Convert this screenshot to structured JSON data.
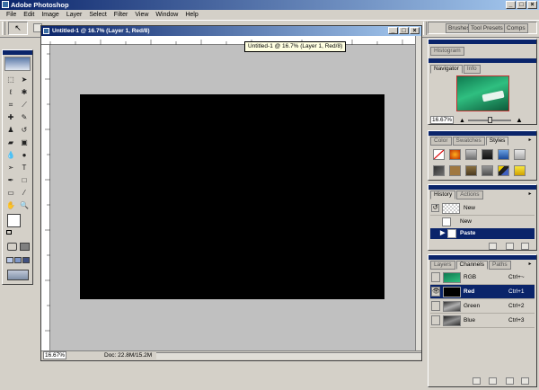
{
  "window": {
    "title": "Adobe Photoshop"
  },
  "menu": [
    "File",
    "Edit",
    "Image",
    "Layer",
    "Select",
    "Filter",
    "View",
    "Window",
    "Help"
  ],
  "palette_well": {
    "tabs": [
      "Brushes",
      "Tool Presets",
      "Comps"
    ]
  },
  "document": {
    "title": "Untitled-1 @ 16.7% (Layer 1, Red/8)",
    "tooltip": "Untitled-1 @ 16.7% (Layer 1, Red/8)",
    "zoom": "16.67%",
    "doc_size": "Doc: 22.8M/15.2M",
    "canvas_color": "#000000"
  },
  "navigator": {
    "tabs": [
      "Histogram",
      "Navigator",
      "Info"
    ],
    "zoom": "16.67%"
  },
  "color_panel": {
    "tabs": [
      "Color",
      "Swatches",
      "Styles"
    ]
  },
  "history": {
    "tabs": [
      "History",
      "Actions"
    ],
    "snapshot_label": "New",
    "items": [
      "New",
      "Paste"
    ]
  },
  "channels": {
    "tabs": [
      "Layers",
      "Channels",
      "Paths"
    ],
    "rows": [
      {
        "name": "RGB",
        "shortcut": "Ctrl+~"
      },
      {
        "name": "Red",
        "shortcut": "Ctrl+1"
      },
      {
        "name": "Green",
        "shortcut": "Ctrl+2"
      },
      {
        "name": "Blue",
        "shortcut": "Ctrl+3"
      }
    ]
  },
  "colors": {
    "title_bar": "#0a246a",
    "selection": "#0a246a",
    "navigator_thumb": "#1f9a6a"
  }
}
